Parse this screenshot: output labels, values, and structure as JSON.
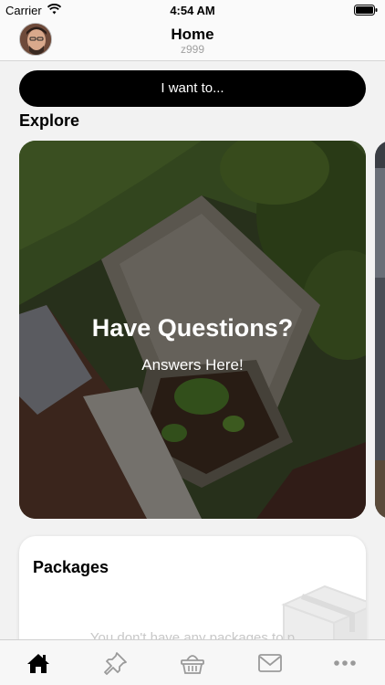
{
  "status_bar": {
    "carrier": "Carrier",
    "time": "4:54 AM"
  },
  "header": {
    "title": "Home",
    "subtitle": "z999"
  },
  "actions": {
    "want_label": "I want to..."
  },
  "explore": {
    "section_title": "Explore",
    "card": {
      "headline": "Have Questions?",
      "subline": "Answers Here!"
    }
  },
  "packages": {
    "title": "Packages",
    "empty_message": "You don't have any packages to p"
  },
  "tab_bar": {
    "tabs": [
      {
        "icon": "home-icon",
        "active": true
      },
      {
        "icon": "pin-icon",
        "active": false
      },
      {
        "icon": "basket-icon",
        "active": false
      },
      {
        "icon": "mail-icon",
        "active": false
      },
      {
        "icon": "more-icon",
        "active": false
      }
    ]
  },
  "colors": {
    "accent": "#000000",
    "inactive_tab": "#9a9a9a",
    "background": "#f2f2f2"
  }
}
